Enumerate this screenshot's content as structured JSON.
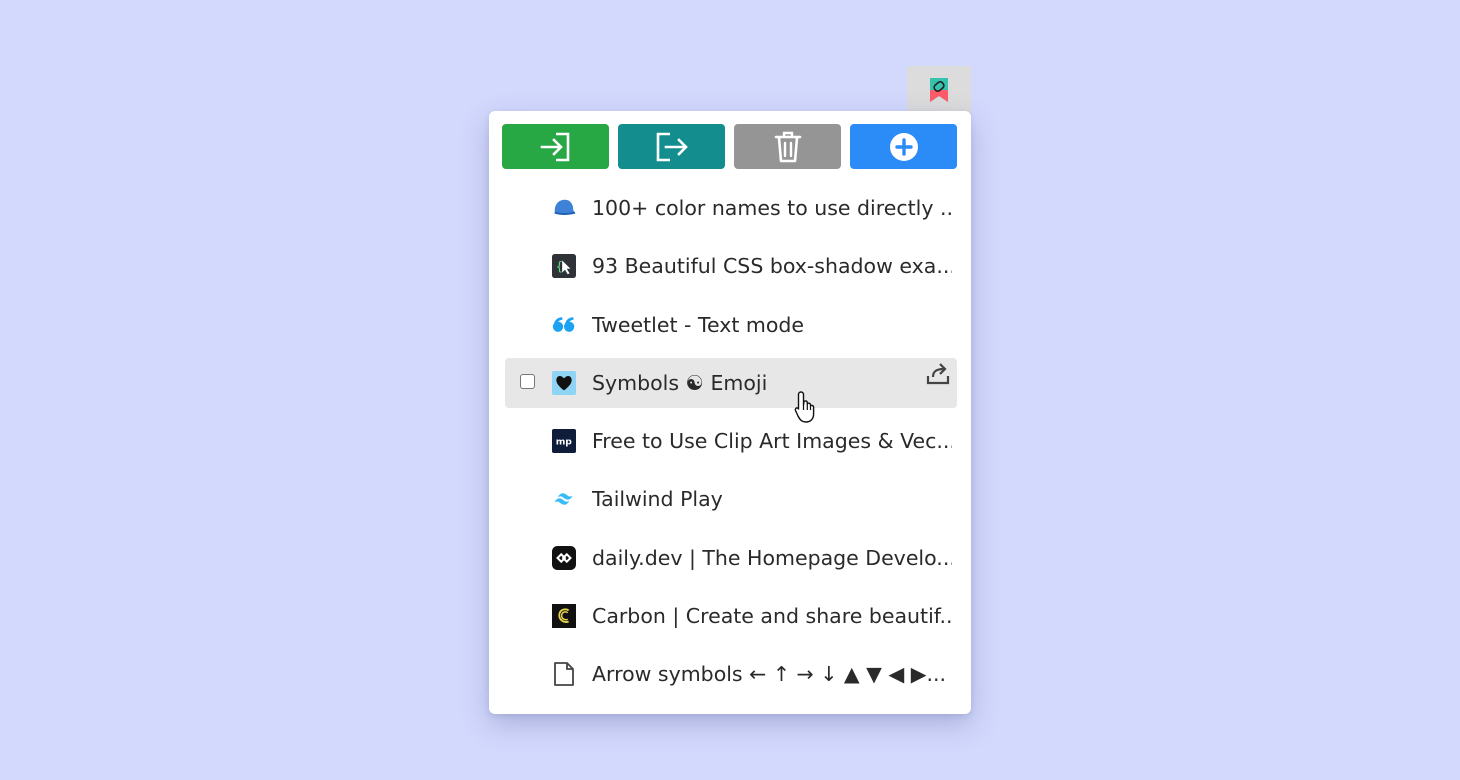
{
  "toolbar": {
    "import_icon": "import-icon",
    "export_icon": "export-icon",
    "delete_icon": "trash-icon",
    "add_icon": "plus-circle-icon",
    "colors": {
      "import": "#28a745",
      "export": "#138d8e",
      "delete": "#959595",
      "add": "#2b8cf7"
    }
  },
  "bookmarks": [
    {
      "title": "100+ color names to use directly ...",
      "icon": "cap-icon"
    },
    {
      "title": "93 Beautiful CSS box-shadow exa...",
      "icon": "css-cursor-icon"
    },
    {
      "title": "Tweetlet - Text mode",
      "icon": "quote-icon"
    },
    {
      "title": "Symbols ☯ Emoji",
      "icon": "heart-icon",
      "hovered": true
    },
    {
      "title": "Free to Use Clip Art Images & Vec...",
      "icon": "mp-icon"
    },
    {
      "title": "Tailwind Play",
      "icon": "tailwind-icon"
    },
    {
      "title": "daily.dev | The Homepage Develo...",
      "icon": "dailydev-icon"
    },
    {
      "title": "Carbon | Create and share beautif...",
      "icon": "carbon-icon"
    },
    {
      "title": "Arrow symbols ← ↑ → ↓ ▲ ▼ ◀ ▶...",
      "icon": "page-icon"
    }
  ]
}
